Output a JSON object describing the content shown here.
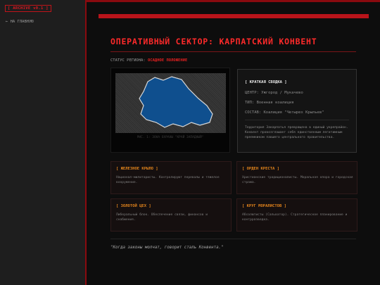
{
  "sidebar": {
    "badge": "[ ARCHIVE v0.1 ]",
    "back_link": "← НА ГЛАВНУЮ"
  },
  "main": {
    "title": "ОПЕРАТИВНЫЙ СЕКТОР: КАРПАТСКИЙ КОНВЕНТ",
    "status_label": "СТАТУС РЕГИОНА:",
    "status_value": "ОСАДНОЕ ПОЛОЖЕНИЕ",
    "status_color": "#e02020",
    "map_caption": "РИС. 1: ЗОНА ОХРАНЫ \"КРАЙ ЗАПАДНЫЙ\"",
    "map_fill_color": "#0f4f8e",
    "summary": {
      "heading": "[ КРАТКАЯ СВОДКА ]",
      "center_label": "ЦЕНТР:",
      "center_value": "Ужгород / Мукачево",
      "type_label": "ТИП:",
      "type_value": "Военная коалиция",
      "composition_label": "СОСТАВ:",
      "composition_value": "Коалиция \"Четырех Крыльев\"",
      "description": "Территория Закарпатья превращена в единый укрепрайон. Конвент провозглашает себя единственным легитимным преемником павшего центрального правительства."
    },
    "factions": [
      {
        "title": "[ ЖЕЛЕЗНОЕ КРЫЛО ]",
        "description": "Национал-милитаристы. Контролируют перевалы и тяжелое вооружение."
      },
      {
        "title": "[ ОРДЕН КРЕСТА ]",
        "description": "Христианские традиционалисты. Моральная опора и городская стража."
      },
      {
        "title": "[ ЗОЛОТОЙ ЦЕХ ]",
        "description": "Либеральный блок. Обеспечение связи, финансов и снабжения."
      },
      {
        "title": "[ КРУГ МОРАЛИСТОВ ]",
        "description": "Абсолютисты (Сальватор). Стратегическое планирование и контрразведка."
      }
    ],
    "quote": "\"Когда законы молчат, говорит сталь Конвента.\""
  },
  "colors": {
    "accent_red": "#b8141a",
    "faction_title": "#e0831c"
  }
}
